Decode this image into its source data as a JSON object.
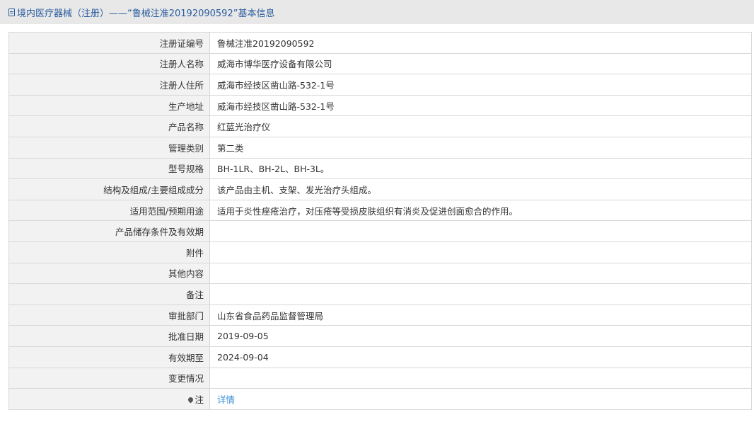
{
  "header": {
    "title": "境内医疗器械（注册）——“鲁械注准20192090592”基本信息",
    "icon": "document-icon"
  },
  "rows": [
    {
      "label": "注册证编号",
      "value": "鲁械注准20192090592"
    },
    {
      "label": "注册人名称",
      "value": "威海市博华医疗设备有限公司"
    },
    {
      "label": "注册人住所",
      "value": "威海市经技区凿山路-532-1号"
    },
    {
      "label": "生产地址",
      "value": "威海市经技区凿山路-532-1号"
    },
    {
      "label": "产品名称",
      "value": "红蓝光治疗仪"
    },
    {
      "label": "管理类别",
      "value": "第二类"
    },
    {
      "label": "型号规格",
      "value": "BH-1LR、BH-2L、BH-3L。"
    },
    {
      "label": "结构及组成/主要组成成分",
      "value": "该产品由主机、支架、发光治疗头组成。"
    },
    {
      "label": "适用范围/预期用途",
      "value": "适用于炎性痤疮治疗，对压疮等受损皮肤组织有消炎及促进创面愈合的作用。"
    },
    {
      "label": "产品储存条件及有效期",
      "value": ""
    },
    {
      "label": "附件",
      "value": ""
    },
    {
      "label": "其他内容",
      "value": ""
    },
    {
      "label": "备注",
      "value": ""
    },
    {
      "label": "审批部门",
      "value": "山东省食品药品监督管理局"
    },
    {
      "label": "批准日期",
      "value": "2019-09-05"
    },
    {
      "label": "有效期至",
      "value": "2024-09-04"
    },
    {
      "label": "变更情况",
      "value": ""
    }
  ],
  "note": {
    "label": "注",
    "icon": "pin-icon",
    "link_text": "详情",
    "link_color": "#3a8fd8"
  },
  "colors": {
    "header_text": "#2a5d9f",
    "header_bg": "#e8e8e8",
    "label_bg": "#f2f2f2",
    "border": "#d8d8d8"
  }
}
